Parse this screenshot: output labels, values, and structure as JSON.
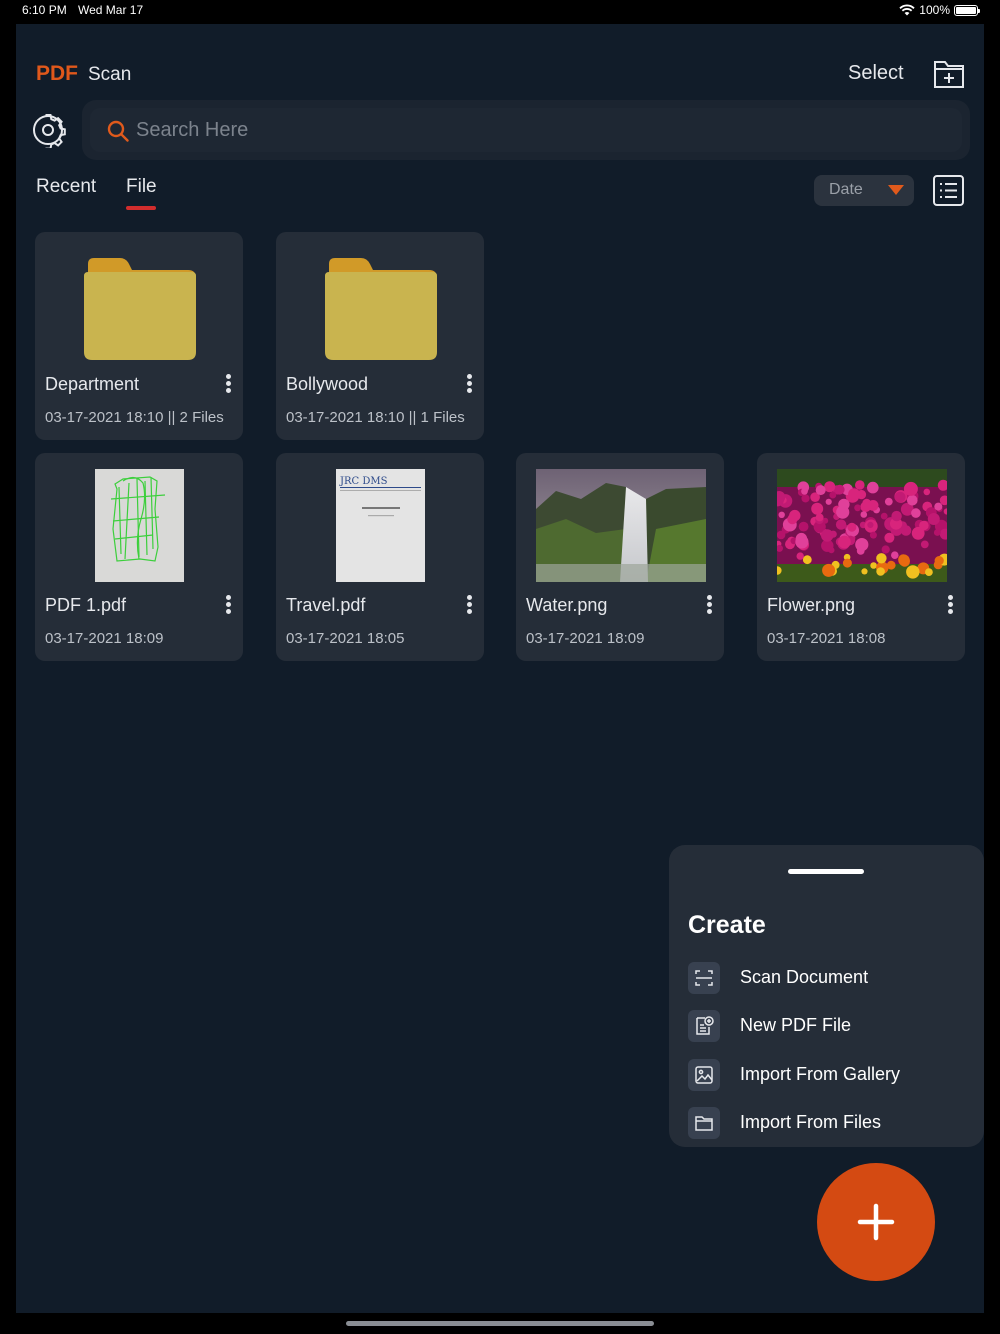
{
  "status_bar": {
    "time": "6:10 PM",
    "date": "Wed Mar 17",
    "battery": "100%"
  },
  "header": {
    "logo_pdf": "PDF",
    "logo_scan": "Scan",
    "select_label": "Select"
  },
  "search": {
    "placeholder": "Search Here",
    "value": ""
  },
  "tabs": [
    {
      "label": "Recent",
      "active": false
    },
    {
      "label": "File",
      "active": true
    }
  ],
  "sort": {
    "selected": "Date"
  },
  "items": [
    {
      "type": "folder",
      "name": "Department",
      "meta": "03-17-2021 18:10 || 2 Files"
    },
    {
      "type": "folder",
      "name": "Bollywood",
      "meta": "03-17-2021 18:10 || 1 Files"
    },
    {
      "type": "pdf",
      "name": "PDF 1.pdf",
      "meta": "03-17-2021 18:09"
    },
    {
      "type": "pdf",
      "name": "Travel.pdf",
      "meta": "03-17-2021 18:05"
    },
    {
      "type": "image",
      "name": "Water.png",
      "meta": "03-17-2021 18:09"
    },
    {
      "type": "image",
      "name": "Flower.png",
      "meta": "03-17-2021 18:08"
    }
  ],
  "create_sheet": {
    "title": "Create",
    "options": [
      {
        "label": "Scan Document",
        "icon": "scan-icon"
      },
      {
        "label": "New PDF File",
        "icon": "new-pdf-icon"
      },
      {
        "label": "Import From Gallery",
        "icon": "gallery-icon"
      },
      {
        "label": "Import From Files",
        "icon": "folder-icon"
      }
    ]
  },
  "travel_doc_header": "JRC DMS",
  "colors": {
    "accent": "#e0581b",
    "background": "#111c29",
    "card": "#252d38",
    "tab_underline": "#d22d2d",
    "fab": "#d44a12"
  }
}
